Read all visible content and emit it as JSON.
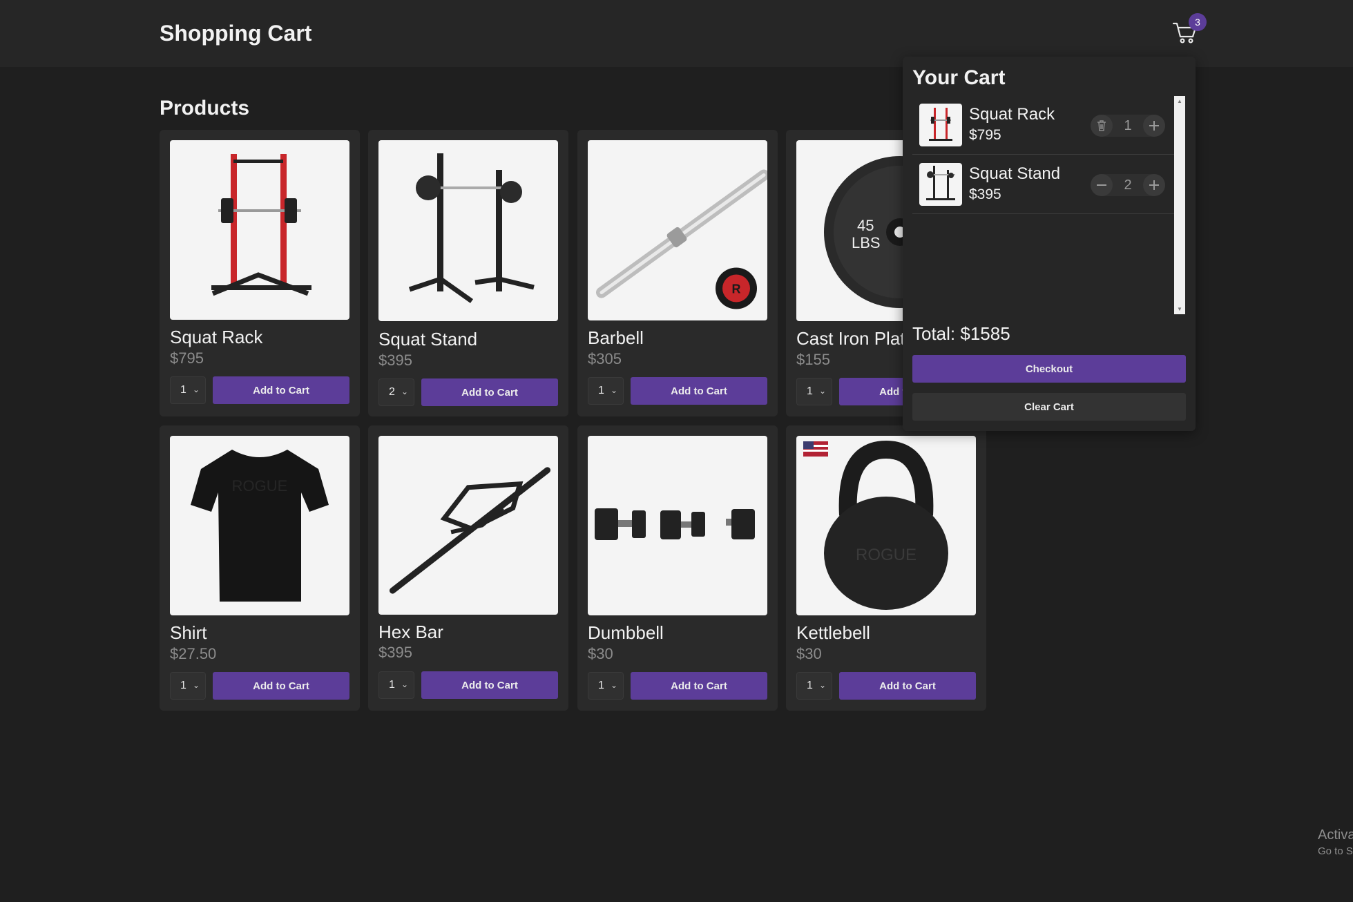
{
  "header": {
    "title": "Shopping Cart",
    "cart_count": "3"
  },
  "products_section": {
    "title": "Products"
  },
  "products": [
    {
      "name": "Squat Rack",
      "price": "$795",
      "qty": "1",
      "button": "Add to Cart",
      "icon": "squat-rack"
    },
    {
      "name": "Squat Stand",
      "price": "$395",
      "qty": "2",
      "button": "Add to Cart",
      "icon": "squat-stand"
    },
    {
      "name": "Barbell",
      "price": "$305",
      "qty": "1",
      "button": "Add to Cart",
      "icon": "barbell"
    },
    {
      "name": "Cast Iron Plate",
      "price": "$155",
      "qty": "1",
      "button": "Add to Cart",
      "icon": "cast-iron-plate"
    },
    {
      "name": "Shirt",
      "price": "$27.50",
      "qty": "1",
      "button": "Add to Cart",
      "icon": "shirt"
    },
    {
      "name": "Hex Bar",
      "price": "$395",
      "qty": "1",
      "button": "Add to Cart",
      "icon": "hex-bar"
    },
    {
      "name": "Dumbbell",
      "price": "$30",
      "qty": "1",
      "button": "Add to Cart",
      "icon": "dumbbell"
    },
    {
      "name": "Kettlebell",
      "price": "$30",
      "qty": "1",
      "button": "Add to Cart",
      "icon": "kettlebell"
    }
  ],
  "cart": {
    "title": "Your Cart",
    "items": [
      {
        "name": "Squat Rack",
        "price": "$795",
        "qty": "1"
      },
      {
        "name": "Squat Stand",
        "price": "$395",
        "qty": "2"
      }
    ],
    "total": "Total: $1585",
    "checkout_label": "Checkout",
    "clear_label": "Clear Cart"
  },
  "overlay": {
    "line1": "Activa",
    "line2": "Go to S"
  },
  "colors": {
    "accent": "#5c3d99",
    "background": "#1f1f1f",
    "card": "#2a2a2a",
    "rack_red": "#c8262a"
  }
}
